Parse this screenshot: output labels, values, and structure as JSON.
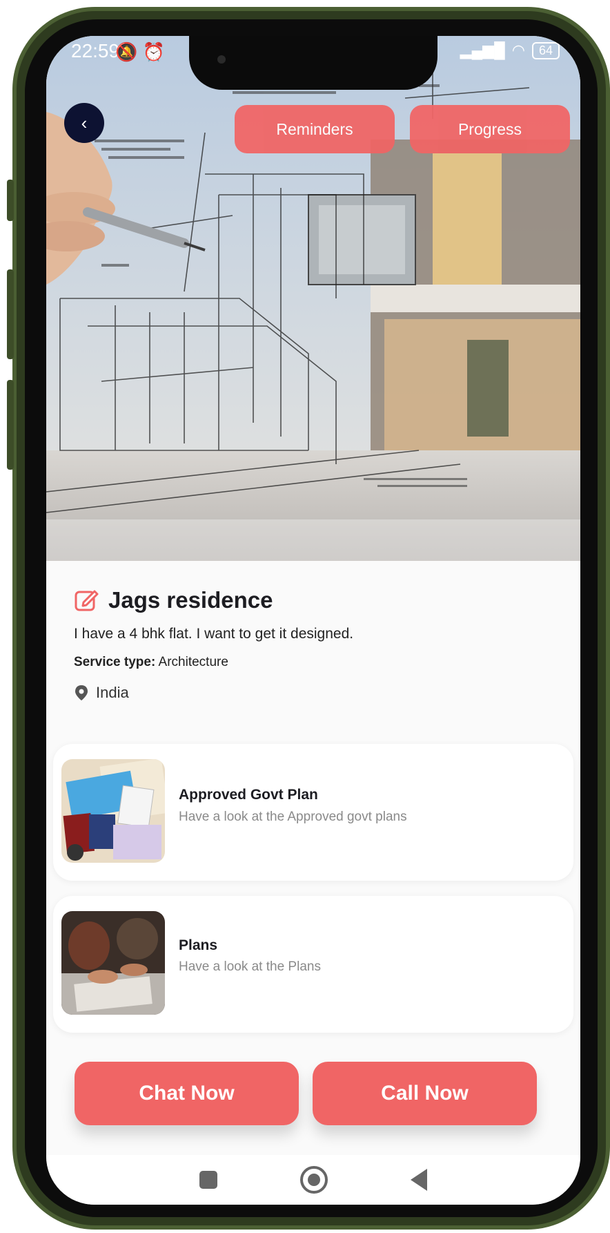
{
  "status_bar": {
    "time": "22:59",
    "battery": "64"
  },
  "header": {
    "back_icon": "chevron-left-icon",
    "reminders_label": "Reminders",
    "progress_label": "Progress"
  },
  "project": {
    "edit_icon": "edit-icon",
    "title": "Jags residence",
    "description": "I have a 4 bhk flat. I want to get it designed.",
    "service_label": "Service type:",
    "service_value": "Architecture",
    "location_icon": "location-pin-icon",
    "location": "India"
  },
  "documents": [
    {
      "title": "Approved Govt Plan",
      "subtitle": "Have a look at the Approved govt plans"
    },
    {
      "title": "Plans",
      "subtitle": "Have a look at the Plans"
    }
  ],
  "actions": {
    "chat_label": "Chat Now",
    "call_label": "Call Now"
  },
  "colors": {
    "accent": "#f06565",
    "back_button": "#0d1232",
    "frame": "#2e3b1f"
  }
}
